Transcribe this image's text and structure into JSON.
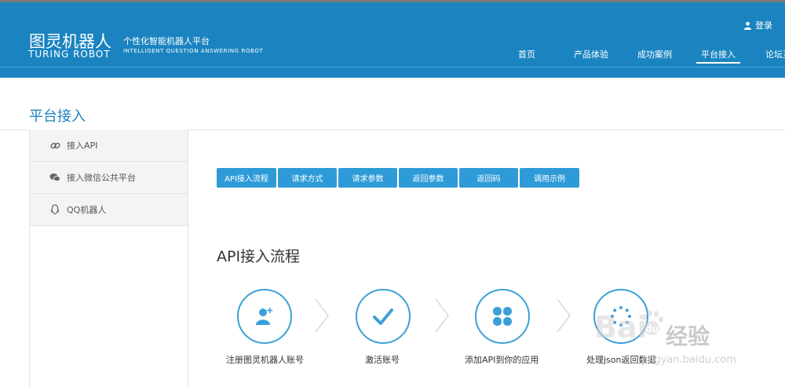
{
  "header": {
    "logo_cn": "图灵机器人",
    "logo_en": "TURING ROBOT",
    "slogan_cn": "个性化智能机器人平台",
    "slogan_en": "INTELLIGENT QUESTION ANSWERING ROBOT",
    "login_label": "登录",
    "nav": [
      {
        "label": "首页"
      },
      {
        "label": "产品体验"
      },
      {
        "label": "成功案例"
      },
      {
        "label": "平台接入"
      },
      {
        "label": "论坛互"
      }
    ],
    "active_nav": "平台接入"
  },
  "page": {
    "title": "平台接入"
  },
  "sidebar": {
    "items": [
      {
        "label": "接入API",
        "icon": "link-icon"
      },
      {
        "label": "接入微信公共平台",
        "icon": "wechat-icon"
      },
      {
        "label": "QQ机器人",
        "icon": "qq-icon"
      }
    ]
  },
  "tabs": [
    {
      "label": "API接入流程"
    },
    {
      "label": "请求方式"
    },
    {
      "label": "请求参数"
    },
    {
      "label": "返回参数"
    },
    {
      "label": "返回码"
    },
    {
      "label": "调用示例"
    }
  ],
  "section": {
    "title": "API接入流程"
  },
  "steps": [
    {
      "label": "注册图灵机器人账号",
      "icon": "add-user-icon"
    },
    {
      "label": "激活账号",
      "icon": "checkmark-icon"
    },
    {
      "label": "添加API到你的应用",
      "icon": "clover-icon"
    },
    {
      "label": "处理json返回数据",
      "icon": "loading-dots-icon"
    }
  ],
  "watermark": {
    "text": "经验",
    "url": "jingyan.baidu.com"
  },
  "colors": {
    "header_bg": "#1b84c0",
    "accent": "#2e9bd8",
    "title": "#1b84c0"
  }
}
